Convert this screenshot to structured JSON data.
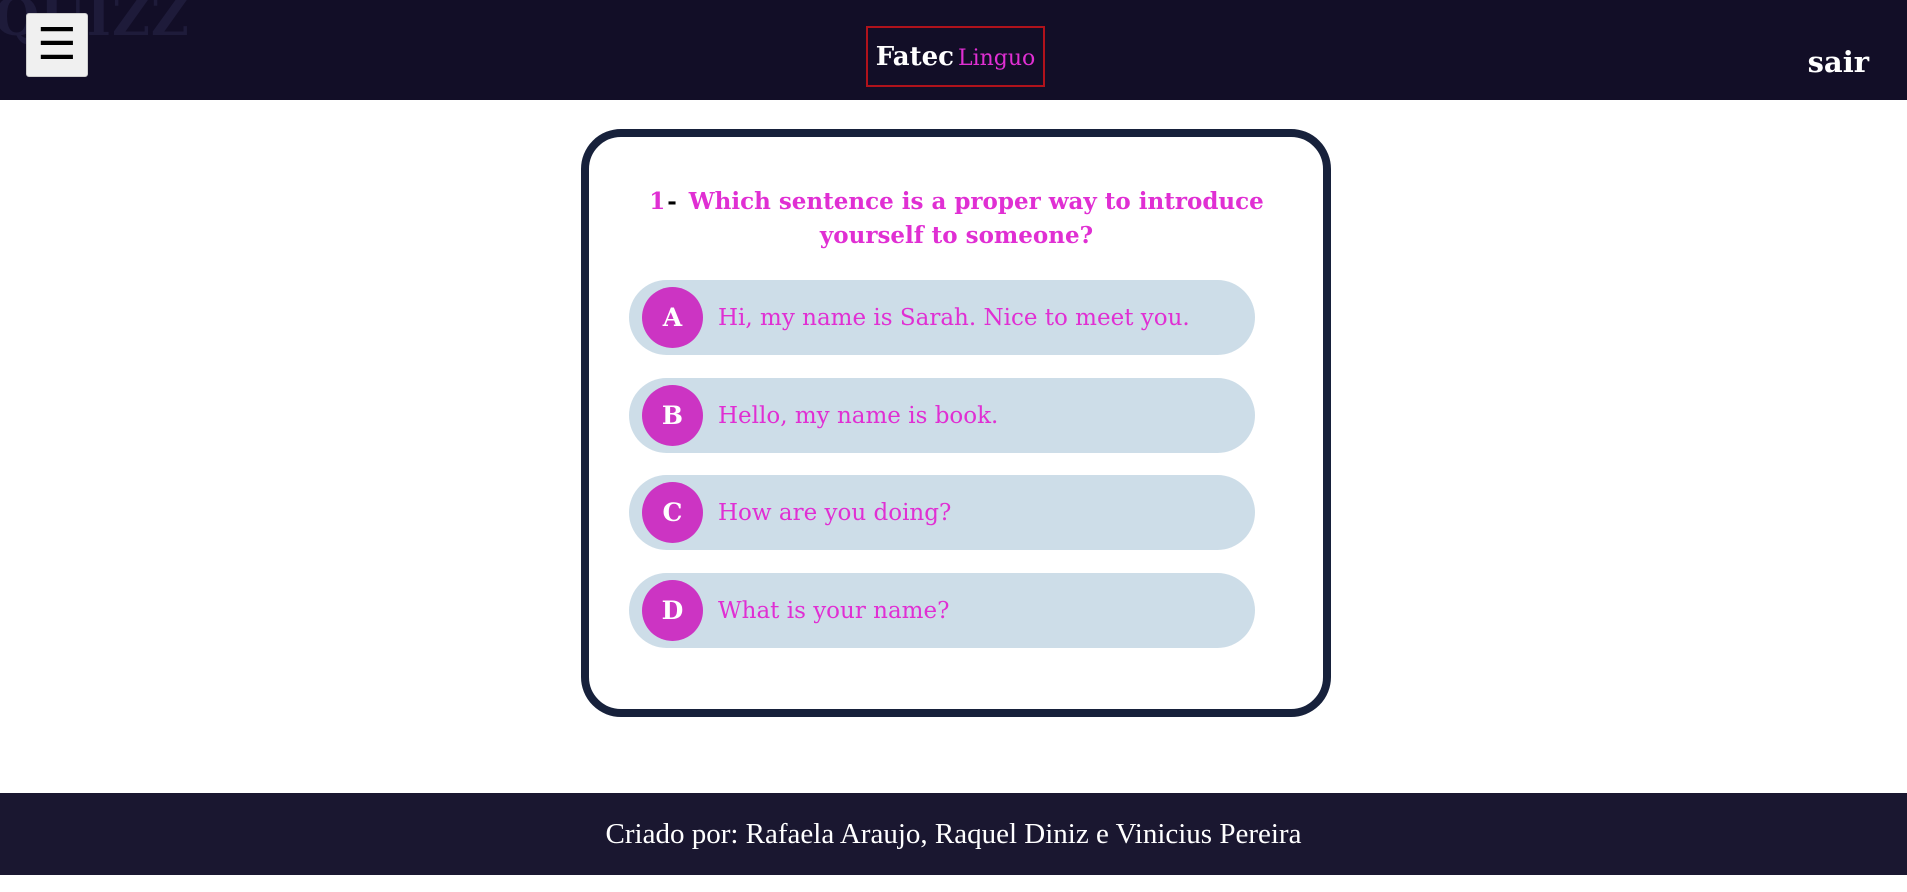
{
  "header": {
    "ghost_title": "QUIZZ",
    "menu_icon": "☰",
    "logo_primary": "Fatec",
    "logo_secondary": "Linguo",
    "logout_label": "sair"
  },
  "quiz": {
    "question_number": "1",
    "question_separator": "-",
    "question_text": "Which sentence is a proper way to introduce yourself to someone?",
    "options": [
      {
        "letter": "A",
        "text": "Hi, my name is Sarah. Nice to meet you."
      },
      {
        "letter": "B",
        "text": "Hello, my name is book."
      },
      {
        "letter": "C",
        "text": "How are you doing?"
      },
      {
        "letter": "D",
        "text": "What is your name?"
      }
    ]
  },
  "footer": {
    "credits": "Criado por: Rafaela Araujo, Raquel Diniz e Vinicius Pereira"
  },
  "colors": {
    "header_bg": "#120e27",
    "accent_pink": "#e02fd3",
    "letter_circle": "#cc34c3",
    "option_bg": "#cddde8",
    "card_border": "#17213b",
    "footer_bg": "#1a1730"
  }
}
